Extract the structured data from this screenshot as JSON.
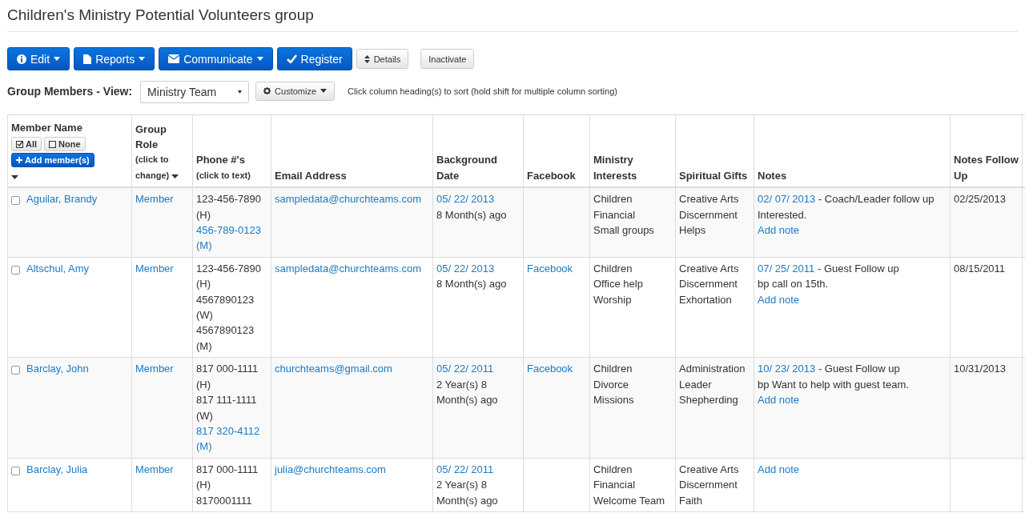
{
  "title": "Children's Ministry Potential Volunteers group",
  "toolbar": [
    {
      "label": "Edit",
      "kind": "primary",
      "caret": true
    },
    {
      "label": "Reports",
      "kind": "primary",
      "caret": true
    },
    {
      "label": "Communicate",
      "kind": "primary",
      "caret": true
    },
    {
      "label": "Register",
      "kind": "primary",
      "caret": false
    },
    {
      "label": "Details",
      "kind": "small",
      "caret": false
    },
    {
      "label": "Inactivate",
      "kind": "small",
      "caret": false
    }
  ],
  "view": {
    "label": "Group Members - View:",
    "value": "Ministry Team",
    "customize": "Customize",
    "hint": "Click column heading(s) to sort (hold shift for multiple column sorting)"
  },
  "table": {
    "member_header": {
      "title": "Member Name",
      "all": "All",
      "none": "None",
      "add": "Add member(s)"
    },
    "columns": [
      {
        "title": "Group Role",
        "sub": "(click to change)"
      },
      {
        "title": "Phone #'s",
        "sub": "(click to text)"
      },
      {
        "title": "Email Address"
      },
      {
        "title": "Background Date"
      },
      {
        "title": "Facebook"
      },
      {
        "title": "Ministry Interests"
      },
      {
        "title": "Spiritual Gifts"
      },
      {
        "title": "Notes"
      },
      {
        "title": "Notes Follow Up"
      }
    ],
    "rows": [
      {
        "checked": false,
        "name": "Aguilar, Brandy",
        "role": "Member",
        "phones": [
          {
            "text": "123-456-7890 (H)",
            "link": false
          },
          {
            "text": "456-789-0123 (M)",
            "link": true
          }
        ],
        "email": "sampledata@churchteams.com",
        "bg_date": "05/ 22/ 2013",
        "bg_age": "8 Month(s) ago",
        "facebook": "",
        "interests": [
          "Children",
          "Financial",
          "Small groups"
        ],
        "gifts": [
          "Creative Arts",
          "Discernment",
          "Helps"
        ],
        "notes": [
          {
            "date": "02/ 07/ 2013",
            "text": " - Coach/Leader follow up"
          }
        ],
        "note_comment": "Interested.",
        "add_note": "Add note",
        "follow_up": "02/25/2013"
      },
      {
        "checked": false,
        "name": "Altschul, Amy",
        "role": "Member",
        "phones": [
          {
            "text": "123-456-7890 (H)",
            "link": false
          },
          {
            "text": "4567890123 (W)",
            "link": false
          },
          {
            "text": "4567890123 (M)",
            "link": false
          }
        ],
        "email": "sampledata@churchteams.com",
        "bg_date": "05/ 22/ 2013",
        "bg_age": "8 Month(s) ago",
        "facebook": "Facebook",
        "interests": [
          "Children",
          "Office help",
          "Worship"
        ],
        "gifts": [
          "Creative Arts",
          "Discernment",
          "Exhortation"
        ],
        "notes": [
          {
            "date": "07/ 25/ 2011",
            "text": " - Guest Follow up"
          }
        ],
        "note_comment": "bp call on 15th.",
        "add_note": "Add note",
        "follow_up": "08/15/2011"
      },
      {
        "checked": false,
        "name": "Barclay, John",
        "role": "Member",
        "phones": [
          {
            "text": "817 000-1111 (H)",
            "link": false
          },
          {
            "text": "817 111-1111 (W)",
            "link": false
          },
          {
            "text": "817 320-4112 (M)",
            "link": true
          }
        ],
        "email": "churchteams@gmail.com",
        "bg_date": "05/ 22/ 2011",
        "bg_age": "2 Year(s) 8 Month(s) ago",
        "facebook": "Facebook",
        "interests": [
          "Children",
          "Divorce",
          "Missions"
        ],
        "gifts": [
          "Administration",
          "Leader",
          "Shepherding"
        ],
        "notes": [
          {
            "date": "10/ 23/ 2013",
            "text": " - Guest Follow up"
          }
        ],
        "note_comment": "bp Want to help with guest team.",
        "add_note": "Add note",
        "follow_up": "10/31/2013"
      },
      {
        "checked": false,
        "name": "Barclay, Julia",
        "role": "Member",
        "phones": [
          {
            "text": "817 000-1111 (H)",
            "link": false
          },
          {
            "text": "8170001111",
            "link": false
          }
        ],
        "email": "julia@churchteams.com",
        "bg_date": "05/ 22/ 2011",
        "bg_age": "2 Year(s) 8 Month(s) ago",
        "facebook": "",
        "interests": [
          "Children",
          "Financial",
          "Welcome Team"
        ],
        "gifts": [
          "Creative Arts",
          "Discernment",
          "Faith"
        ],
        "notes": [],
        "note_comment": "",
        "add_note": "Add note",
        "follow_up": ""
      }
    ]
  }
}
